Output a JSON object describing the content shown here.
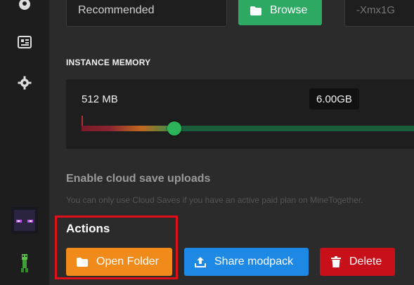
{
  "sidebar": {
    "icons": [
      "palette-icon",
      "news-icon",
      "gear-icon"
    ],
    "avatars": [
      "enderman-avatar",
      "creeper-avatar"
    ]
  },
  "top": {
    "recommended": "Recommended",
    "browse_label": "Browse",
    "args_value": "-Xmx1G"
  },
  "memory": {
    "label": "INSTANCE MEMORY",
    "min_label": "512 MB",
    "value_label": "6.00GB",
    "slider_fraction": 0.28
  },
  "cloud": {
    "title": "Enable cloud save uploads",
    "hint": "You can only use Cloud Saves if you have an active paid plan on MineTogether."
  },
  "actions": {
    "title": "Actions",
    "open_folder": "Open Folder",
    "share": "Share modpack",
    "delete": "Delete"
  },
  "colors": {
    "green": "#2ea964",
    "orange": "#f08a1a",
    "blue": "#1e88e5",
    "red": "#c8101a",
    "highlight": "#e0101a"
  }
}
